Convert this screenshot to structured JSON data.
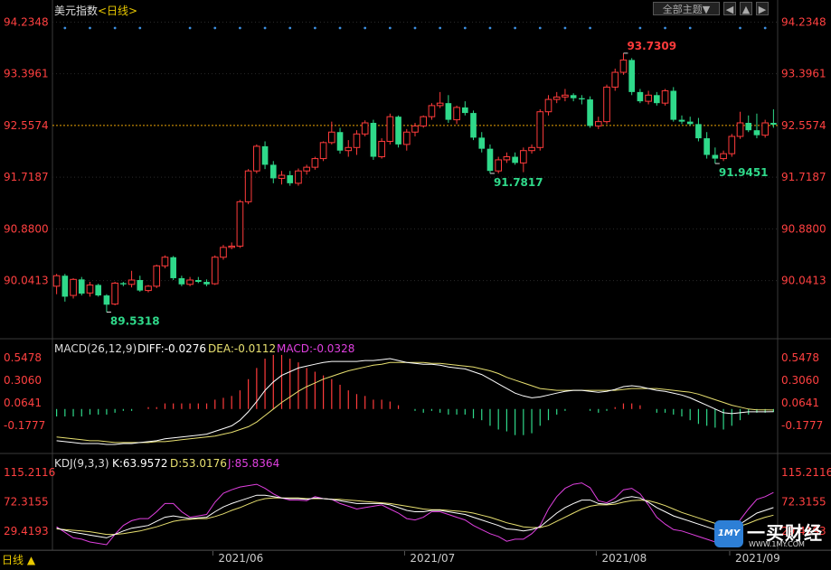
{
  "header": {
    "title": "美元指数",
    "period": "<日线>",
    "theme_button": "全部主题▼",
    "icon_buttons": [
      "◀",
      "▲",
      "▶"
    ]
  },
  "colors": {
    "up": "#ff3b3b",
    "down": "#2fd98a",
    "grid": "#2a2a2a",
    "price_axis_label": "#ff4040",
    "dotted_line": "#e8a000",
    "dots": "#3d8fe0",
    "diff": "#ffffff",
    "dea": "#e8e070",
    "kdj_k": "#ffffff",
    "kdj_d": "#e8e070",
    "kdj_j": "#e040e0"
  },
  "main_chart": {
    "y_ticks": [
      "94.2348",
      "93.3961",
      "92.5574",
      "91.7187",
      "90.8800",
      "90.0413"
    ],
    "current_price": "92.5574",
    "annotations": {
      "high": "93.7309",
      "low1": "89.5318",
      "low2": "91.7817",
      "low3": "91.9451"
    }
  },
  "macd": {
    "label": "MACD(26,12,9)",
    "diff_label": "DIFF:-0.0276",
    "dea_label": "DEA:-0.0112",
    "macd_label": "MACD:-0.0328",
    "y_ticks": [
      "0.5478",
      "0.3060",
      "0.0641",
      "-0.1777"
    ]
  },
  "kdj": {
    "label": "KDJ(9,3,3)",
    "k_label": "K:63.9572",
    "d_label": "D:53.0176",
    "j_label": "J:85.8364",
    "y_ticks": [
      "115.2116",
      "72.3155",
      "29.4193"
    ]
  },
  "x_axis": {
    "labels": [
      "2021/06",
      "2021/07",
      "2021/08",
      "2021/09"
    ]
  },
  "bottom_tab": "日线 ▲",
  "watermark": {
    "badge": "1MY",
    "name": "一买财经",
    "url": "WWW.1MY.COM"
  },
  "chart_data": {
    "type": "candlestick",
    "title": "美元指数",
    "ylim": [
      89.2,
      94.3
    ],
    "candles": [
      {
        "o": 89.95,
        "h": 90.15,
        "l": 89.82,
        "c": 90.12
      },
      {
        "o": 90.12,
        "h": 90.15,
        "l": 89.7,
        "c": 89.78
      },
      {
        "o": 89.8,
        "h": 90.08,
        "l": 89.75,
        "c": 90.06
      },
      {
        "o": 90.06,
        "h": 90.1,
        "l": 89.8,
        "c": 89.83
      },
      {
        "o": 89.84,
        "h": 90.02,
        "l": 89.78,
        "c": 89.97
      },
      {
        "o": 89.97,
        "h": 89.99,
        "l": 89.78,
        "c": 89.8
      },
      {
        "o": 89.8,
        "h": 89.82,
        "l": 89.53,
        "c": 89.65
      },
      {
        "o": 89.66,
        "h": 90.02,
        "l": 89.64,
        "c": 90.0
      },
      {
        "o": 90.0,
        "h": 90.02,
        "l": 89.95,
        "c": 89.98
      },
      {
        "o": 89.98,
        "h": 90.2,
        "l": 89.93,
        "c": 90.05
      },
      {
        "o": 90.05,
        "h": 90.12,
        "l": 89.86,
        "c": 89.88
      },
      {
        "o": 89.88,
        "h": 89.97,
        "l": 89.85,
        "c": 89.95
      },
      {
        "o": 89.95,
        "h": 90.3,
        "l": 89.92,
        "c": 90.28
      },
      {
        "o": 90.28,
        "h": 90.45,
        "l": 90.24,
        "c": 90.42
      },
      {
        "o": 90.42,
        "h": 90.44,
        "l": 90.05,
        "c": 90.08
      },
      {
        "o": 90.08,
        "h": 90.12,
        "l": 89.95,
        "c": 89.98
      },
      {
        "o": 89.98,
        "h": 90.1,
        "l": 89.95,
        "c": 90.05
      },
      {
        "o": 90.05,
        "h": 90.1,
        "l": 90.0,
        "c": 90.02
      },
      {
        "o": 90.02,
        "h": 90.06,
        "l": 89.95,
        "c": 89.98
      },
      {
        "o": 89.99,
        "h": 90.45,
        "l": 89.97,
        "c": 90.42
      },
      {
        "o": 90.42,
        "h": 90.62,
        "l": 90.38,
        "c": 90.58
      },
      {
        "o": 90.58,
        "h": 90.66,
        "l": 90.55,
        "c": 90.6
      },
      {
        "o": 90.6,
        "h": 91.35,
        "l": 90.57,
        "c": 91.32
      },
      {
        "o": 91.32,
        "h": 91.85,
        "l": 91.28,
        "c": 91.82
      },
      {
        "o": 91.82,
        "h": 92.25,
        "l": 91.78,
        "c": 92.22
      },
      {
        "o": 92.22,
        "h": 92.3,
        "l": 91.85,
        "c": 91.92
      },
      {
        "o": 91.92,
        "h": 91.98,
        "l": 91.62,
        "c": 91.7
      },
      {
        "o": 91.7,
        "h": 91.82,
        "l": 91.6,
        "c": 91.75
      },
      {
        "o": 91.75,
        "h": 91.82,
        "l": 91.58,
        "c": 91.62
      },
      {
        "o": 91.62,
        "h": 91.86,
        "l": 91.58,
        "c": 91.82
      },
      {
        "o": 91.82,
        "h": 91.92,
        "l": 91.76,
        "c": 91.88
      },
      {
        "o": 91.88,
        "h": 92.05,
        "l": 91.84,
        "c": 92.02
      },
      {
        "o": 92.02,
        "h": 92.3,
        "l": 91.98,
        "c": 92.28
      },
      {
        "o": 92.28,
        "h": 92.62,
        "l": 92.25,
        "c": 92.45
      },
      {
        "o": 92.45,
        "h": 92.52,
        "l": 92.1,
        "c": 92.15
      },
      {
        "o": 92.15,
        "h": 92.32,
        "l": 92.05,
        "c": 92.2
      },
      {
        "o": 92.2,
        "h": 92.48,
        "l": 92.08,
        "c": 92.42
      },
      {
        "o": 92.42,
        "h": 92.64,
        "l": 92.38,
        "c": 92.6
      },
      {
        "o": 92.6,
        "h": 92.65,
        "l": 92.0,
        "c": 92.05
      },
      {
        "o": 92.05,
        "h": 92.35,
        "l": 92.02,
        "c": 92.3
      },
      {
        "o": 92.3,
        "h": 92.75,
        "l": 92.25,
        "c": 92.7
      },
      {
        "o": 92.7,
        "h": 92.72,
        "l": 92.2,
        "c": 92.25
      },
      {
        "o": 92.25,
        "h": 92.5,
        "l": 92.15,
        "c": 92.45
      },
      {
        "o": 92.45,
        "h": 92.6,
        "l": 92.38,
        "c": 92.55
      },
      {
        "o": 92.55,
        "h": 92.72,
        "l": 92.52,
        "c": 92.7
      },
      {
        "o": 92.7,
        "h": 92.92,
        "l": 92.65,
        "c": 92.88
      },
      {
        "o": 92.88,
        "h": 93.1,
        "l": 92.84,
        "c": 92.92
      },
      {
        "o": 92.92,
        "h": 93.05,
        "l": 92.6,
        "c": 92.65
      },
      {
        "o": 92.65,
        "h": 92.88,
        "l": 92.58,
        "c": 92.85
      },
      {
        "o": 92.85,
        "h": 92.95,
        "l": 92.72,
        "c": 92.76
      },
      {
        "o": 92.76,
        "h": 92.8,
        "l": 92.32,
        "c": 92.36
      },
      {
        "o": 92.36,
        "h": 92.45,
        "l": 92.12,
        "c": 92.18
      },
      {
        "o": 92.18,
        "h": 92.25,
        "l": 91.78,
        "c": 91.82
      },
      {
        "o": 91.82,
        "h": 92.05,
        "l": 91.78,
        "c": 92.0
      },
      {
        "o": 92.0,
        "h": 92.12,
        "l": 91.95,
        "c": 92.05
      },
      {
        "o": 92.05,
        "h": 92.12,
        "l": 91.92,
        "c": 91.95
      },
      {
        "o": 91.95,
        "h": 92.2,
        "l": 91.8,
        "c": 92.15
      },
      {
        "o": 92.15,
        "h": 92.25,
        "l": 92.1,
        "c": 92.2
      },
      {
        "o": 92.2,
        "h": 92.82,
        "l": 92.15,
        "c": 92.78
      },
      {
        "o": 92.78,
        "h": 93.05,
        "l": 92.72,
        "c": 92.98
      },
      {
        "o": 92.98,
        "h": 93.1,
        "l": 92.92,
        "c": 93.02
      },
      {
        "o": 93.02,
        "h": 93.15,
        "l": 92.95,
        "c": 93.05
      },
      {
        "o": 93.05,
        "h": 93.08,
        "l": 92.95,
        "c": 93.0
      },
      {
        "o": 93.0,
        "h": 93.05,
        "l": 92.9,
        "c": 92.98
      },
      {
        "o": 92.98,
        "h": 93.03,
        "l": 92.52,
        "c": 92.55
      },
      {
        "o": 92.55,
        "h": 92.7,
        "l": 92.5,
        "c": 92.62
      },
      {
        "o": 92.62,
        "h": 93.22,
        "l": 92.58,
        "c": 93.18
      },
      {
        "o": 93.18,
        "h": 93.48,
        "l": 93.12,
        "c": 93.42
      },
      {
        "o": 93.42,
        "h": 93.73,
        "l": 93.38,
        "c": 93.62
      },
      {
        "o": 93.62,
        "h": 93.65,
        "l": 93.05,
        "c": 93.1
      },
      {
        "o": 93.1,
        "h": 93.15,
        "l": 92.92,
        "c": 92.95
      },
      {
        "o": 92.95,
        "h": 93.12,
        "l": 92.9,
        "c": 93.05
      },
      {
        "o": 93.05,
        "h": 93.1,
        "l": 92.88,
        "c": 92.92
      },
      {
        "o": 92.92,
        "h": 93.15,
        "l": 92.88,
        "c": 93.12
      },
      {
        "o": 93.12,
        "h": 93.18,
        "l": 92.62,
        "c": 92.65
      },
      {
        "o": 92.65,
        "h": 92.72,
        "l": 92.58,
        "c": 92.62
      },
      {
        "o": 92.62,
        "h": 92.7,
        "l": 92.55,
        "c": 92.58
      },
      {
        "o": 92.58,
        "h": 92.68,
        "l": 92.3,
        "c": 92.35
      },
      {
        "o": 92.35,
        "h": 92.45,
        "l": 92.02,
        "c": 92.08
      },
      {
        "o": 92.08,
        "h": 92.2,
        "l": 91.94,
        "c": 92.02
      },
      {
        "o": 92.02,
        "h": 92.15,
        "l": 91.98,
        "c": 92.1
      },
      {
        "o": 92.1,
        "h": 92.42,
        "l": 92.05,
        "c": 92.38
      },
      {
        "o": 92.38,
        "h": 92.78,
        "l": 92.34,
        "c": 92.6
      },
      {
        "o": 92.6,
        "h": 92.72,
        "l": 92.45,
        "c": 92.48
      },
      {
        "o": 92.48,
        "h": 92.75,
        "l": 92.35,
        "c": 92.4
      },
      {
        "o": 92.4,
        "h": 92.65,
        "l": 92.36,
        "c": 92.6
      },
      {
        "o": 92.6,
        "h": 92.82,
        "l": 92.52,
        "c": 92.57
      }
    ],
    "macd": {
      "diff": [
        -0.34,
        -0.35,
        -0.36,
        -0.37,
        -0.37,
        -0.37,
        -0.38,
        -0.38,
        -0.37,
        -0.37,
        -0.36,
        -0.35,
        -0.34,
        -0.32,
        -0.31,
        -0.3,
        -0.29,
        -0.28,
        -0.27,
        -0.24,
        -0.21,
        -0.18,
        -0.12,
        -0.03,
        0.08,
        0.2,
        0.29,
        0.36,
        0.4,
        0.44,
        0.46,
        0.48,
        0.5,
        0.51,
        0.51,
        0.51,
        0.51,
        0.52,
        0.52,
        0.53,
        0.54,
        0.52,
        0.5,
        0.49,
        0.48,
        0.48,
        0.47,
        0.45,
        0.44,
        0.43,
        0.4,
        0.37,
        0.32,
        0.27,
        0.22,
        0.17,
        0.14,
        0.12,
        0.13,
        0.15,
        0.17,
        0.19,
        0.2,
        0.2,
        0.19,
        0.18,
        0.19,
        0.21,
        0.24,
        0.25,
        0.24,
        0.22,
        0.2,
        0.19,
        0.17,
        0.15,
        0.12,
        0.08,
        0.04,
        0.0,
        -0.04,
        -0.05,
        -0.04,
        -0.03,
        -0.03,
        -0.03,
        -0.028
      ],
      "dea": [
        -0.3,
        -0.31,
        -0.32,
        -0.33,
        -0.34,
        -0.34,
        -0.35,
        -0.36,
        -0.36,
        -0.36,
        -0.36,
        -0.36,
        -0.35,
        -0.35,
        -0.34,
        -0.33,
        -0.32,
        -0.31,
        -0.3,
        -0.29,
        -0.27,
        -0.25,
        -0.22,
        -0.19,
        -0.14,
        -0.07,
        0.0,
        0.07,
        0.13,
        0.19,
        0.24,
        0.28,
        0.32,
        0.35,
        0.38,
        0.41,
        0.43,
        0.45,
        0.47,
        0.48,
        0.5,
        0.5,
        0.5,
        0.5,
        0.5,
        0.49,
        0.49,
        0.48,
        0.47,
        0.46,
        0.45,
        0.43,
        0.41,
        0.38,
        0.34,
        0.31,
        0.28,
        0.25,
        0.22,
        0.21,
        0.2,
        0.2,
        0.2,
        0.2,
        0.2,
        0.2,
        0.2,
        0.2,
        0.21,
        0.22,
        0.22,
        0.22,
        0.22,
        0.21,
        0.2,
        0.19,
        0.18,
        0.16,
        0.13,
        0.1,
        0.07,
        0.04,
        0.02,
        0.0,
        -0.01,
        -0.01,
        -0.011
      ],
      "hist": [
        -0.08,
        -0.08,
        -0.08,
        -0.08,
        -0.06,
        -0.06,
        -0.06,
        -0.04,
        -0.02,
        -0.02,
        0.0,
        0.02,
        0.02,
        0.06,
        0.06,
        0.06,
        0.06,
        0.06,
        0.06,
        0.1,
        0.12,
        0.14,
        0.2,
        0.32,
        0.44,
        0.54,
        0.58,
        0.58,
        0.54,
        0.5,
        0.44,
        0.4,
        0.36,
        0.32,
        0.26,
        0.2,
        0.16,
        0.14,
        0.1,
        0.1,
        0.08,
        0.04,
        0.0,
        -0.02,
        -0.04,
        -0.02,
        -0.04,
        -0.06,
        -0.06,
        -0.06,
        -0.1,
        -0.12,
        -0.18,
        -0.22,
        -0.24,
        -0.28,
        -0.28,
        -0.26,
        -0.18,
        -0.12,
        -0.06,
        -0.02,
        0.0,
        0.0,
        -0.02,
        -0.04,
        -0.02,
        0.02,
        0.06,
        0.06,
        0.04,
        0.0,
        -0.04,
        -0.04,
        -0.06,
        -0.08,
        -0.12,
        -0.16,
        -0.18,
        -0.2,
        -0.22,
        -0.18,
        -0.12,
        -0.06,
        -0.04,
        -0.04,
        -0.0328
      ]
    },
    "kdj": {
      "k": [
        34,
        31,
        28,
        26,
        24,
        22,
        20,
        25,
        30,
        34,
        36,
        38,
        44,
        50,
        52,
        50,
        48,
        49,
        50,
        58,
        65,
        70,
        74,
        78,
        82,
        82,
        80,
        78,
        77,
        77,
        76,
        78,
        77,
        76,
        74,
        72,
        70,
        70,
        70,
        70,
        68,
        64,
        60,
        58,
        58,
        60,
        60,
        58,
        56,
        54,
        50,
        46,
        42,
        38,
        33,
        32,
        30,
        32,
        36,
        46,
        56,
        64,
        70,
        75,
        75,
        70,
        69,
        72,
        78,
        80,
        78,
        72,
        64,
        58,
        52,
        48,
        44,
        40,
        36,
        32,
        30,
        34,
        40,
        48,
        56,
        60,
        64
      ],
      "d": [
        33,
        32,
        31,
        30,
        29,
        27,
        25,
        25,
        26,
        28,
        30,
        33,
        36,
        40,
        44,
        46,
        47,
        48,
        48,
        51,
        55,
        60,
        64,
        69,
        74,
        77,
        78,
        78,
        78,
        78,
        77,
        77,
        77,
        76,
        76,
        75,
        74,
        73,
        72,
        71,
        70,
        68,
        66,
        64,
        62,
        61,
        61,
        60,
        59,
        58,
        56,
        53,
        50,
        46,
        42,
        39,
        36,
        35,
        35,
        38,
        44,
        50,
        56,
        62,
        66,
        68,
        68,
        69,
        72,
        74,
        75,
        74,
        71,
        67,
        62,
        57,
        53,
        49,
        45,
        41,
        37,
        36,
        37,
        41,
        46,
        50,
        53
      ],
      "j": [
        36,
        28,
        20,
        18,
        14,
        12,
        10,
        25,
        38,
        45,
        48,
        48,
        58,
        70,
        70,
        58,
        50,
        52,
        54,
        72,
        85,
        90,
        94,
        96,
        98,
        92,
        84,
        78,
        75,
        75,
        74,
        80,
        77,
        76,
        70,
        66,
        62,
        64,
        66,
        68,
        62,
        56,
        48,
        46,
        50,
        58,
        58,
        54,
        50,
        46,
        38,
        32,
        26,
        22,
        15,
        18,
        18,
        26,
        38,
        62,
        80,
        92,
        98,
        100,
        93,
        74,
        71,
        78,
        90,
        92,
        84,
        68,
        50,
        40,
        32,
        30,
        26,
        22,
        18,
        14,
        16,
        30,
        46,
        62,
        76,
        80,
        86
      ]
    }
  }
}
